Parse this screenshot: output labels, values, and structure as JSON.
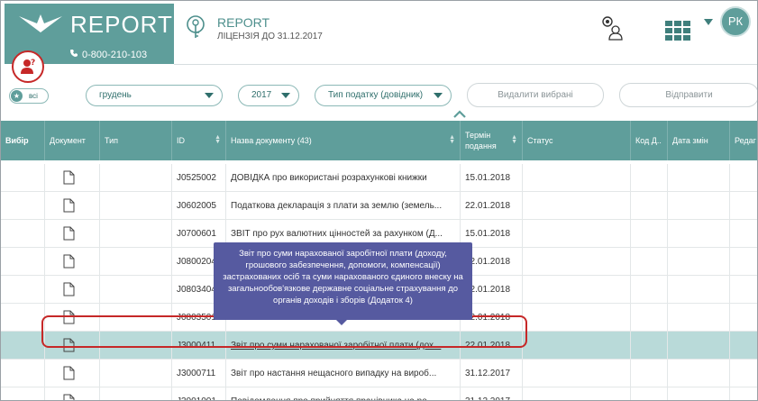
{
  "brand": {
    "name": "REPORT",
    "phone": "0-800-210-103"
  },
  "product": {
    "title": "REPORT",
    "license": "ЛІЦЕНЗІЯ ДО 31.12.2017"
  },
  "user": {
    "initials": "РК"
  },
  "colors": {
    "accent": "#5f9e9b",
    "tooltip": "#565aa0",
    "highlight": "#c62828",
    "selected_row": "#b9dad9"
  },
  "filters": {
    "all_label": "всі",
    "month": "грудень",
    "year": "2017",
    "tax_type": "Тип податку (довідник)",
    "delete_label": "Видалити вибрані",
    "send_label": "Відправити"
  },
  "table": {
    "headers": {
      "select": "Вибір",
      "document": "Документ",
      "type": "Тип",
      "id": "ID",
      "name": "Назва документу (43)",
      "term_line1": "Термін",
      "term_line2": "подання",
      "status": "Статус",
      "code": "Код Д..",
      "changed": "Дата змін",
      "edit": "Редаг"
    },
    "rows": [
      {
        "id": "J0525002",
        "name": "ДОВІДКА про використані розрахункові книжки",
        "term": "15.01.2018"
      },
      {
        "id": "J0602005",
        "name": "Податкова декларація з плати за землю (земель...",
        "term": "22.01.2018"
      },
      {
        "id": "J0700601",
        "name": "ЗВІТ про рух валютних цінностей за рахунком (Д...",
        "term": "15.01.2018"
      },
      {
        "id": "J0800204",
        "name": "",
        "term": "22.01.2018"
      },
      {
        "id": "J0803404",
        "name": "",
        "term": "22.01.2018"
      },
      {
        "id": "J0803501",
        "name": "",
        "term": "22.01.2018"
      },
      {
        "id": "J3000411",
        "name": "Звіт про суми нарахованої заробітної плати (дох...",
        "term": "22.01.2018"
      },
      {
        "id": "J3000711",
        "name": "Звіт про настання нещасного випадку на вироб...",
        "term": "31.12.2017"
      },
      {
        "id": "J3001001",
        "name": "Повідомлення про прийняття працівника на ро...",
        "term": "31.12.2017"
      }
    ]
  },
  "tooltip": {
    "text": "Звіт про суми нарахованої заробітної плати (доходу, грошового забезпечення, допомоги, компенсації) застрахованих осіб та суми нарахованого єдиного внеску на загальнообов'язкове державне соціальне страхування до органів доходів і зборів (Додаток 4)"
  },
  "icons": [
    "paper-boat-logo-icon",
    "phone-icon",
    "help-user-icon",
    "license-key-icon",
    "settings-user-icon",
    "apps-grid-icon",
    "chevron-down-icon",
    "star-icon",
    "chevron-up-icon",
    "document-icon",
    "sort-icon"
  ]
}
